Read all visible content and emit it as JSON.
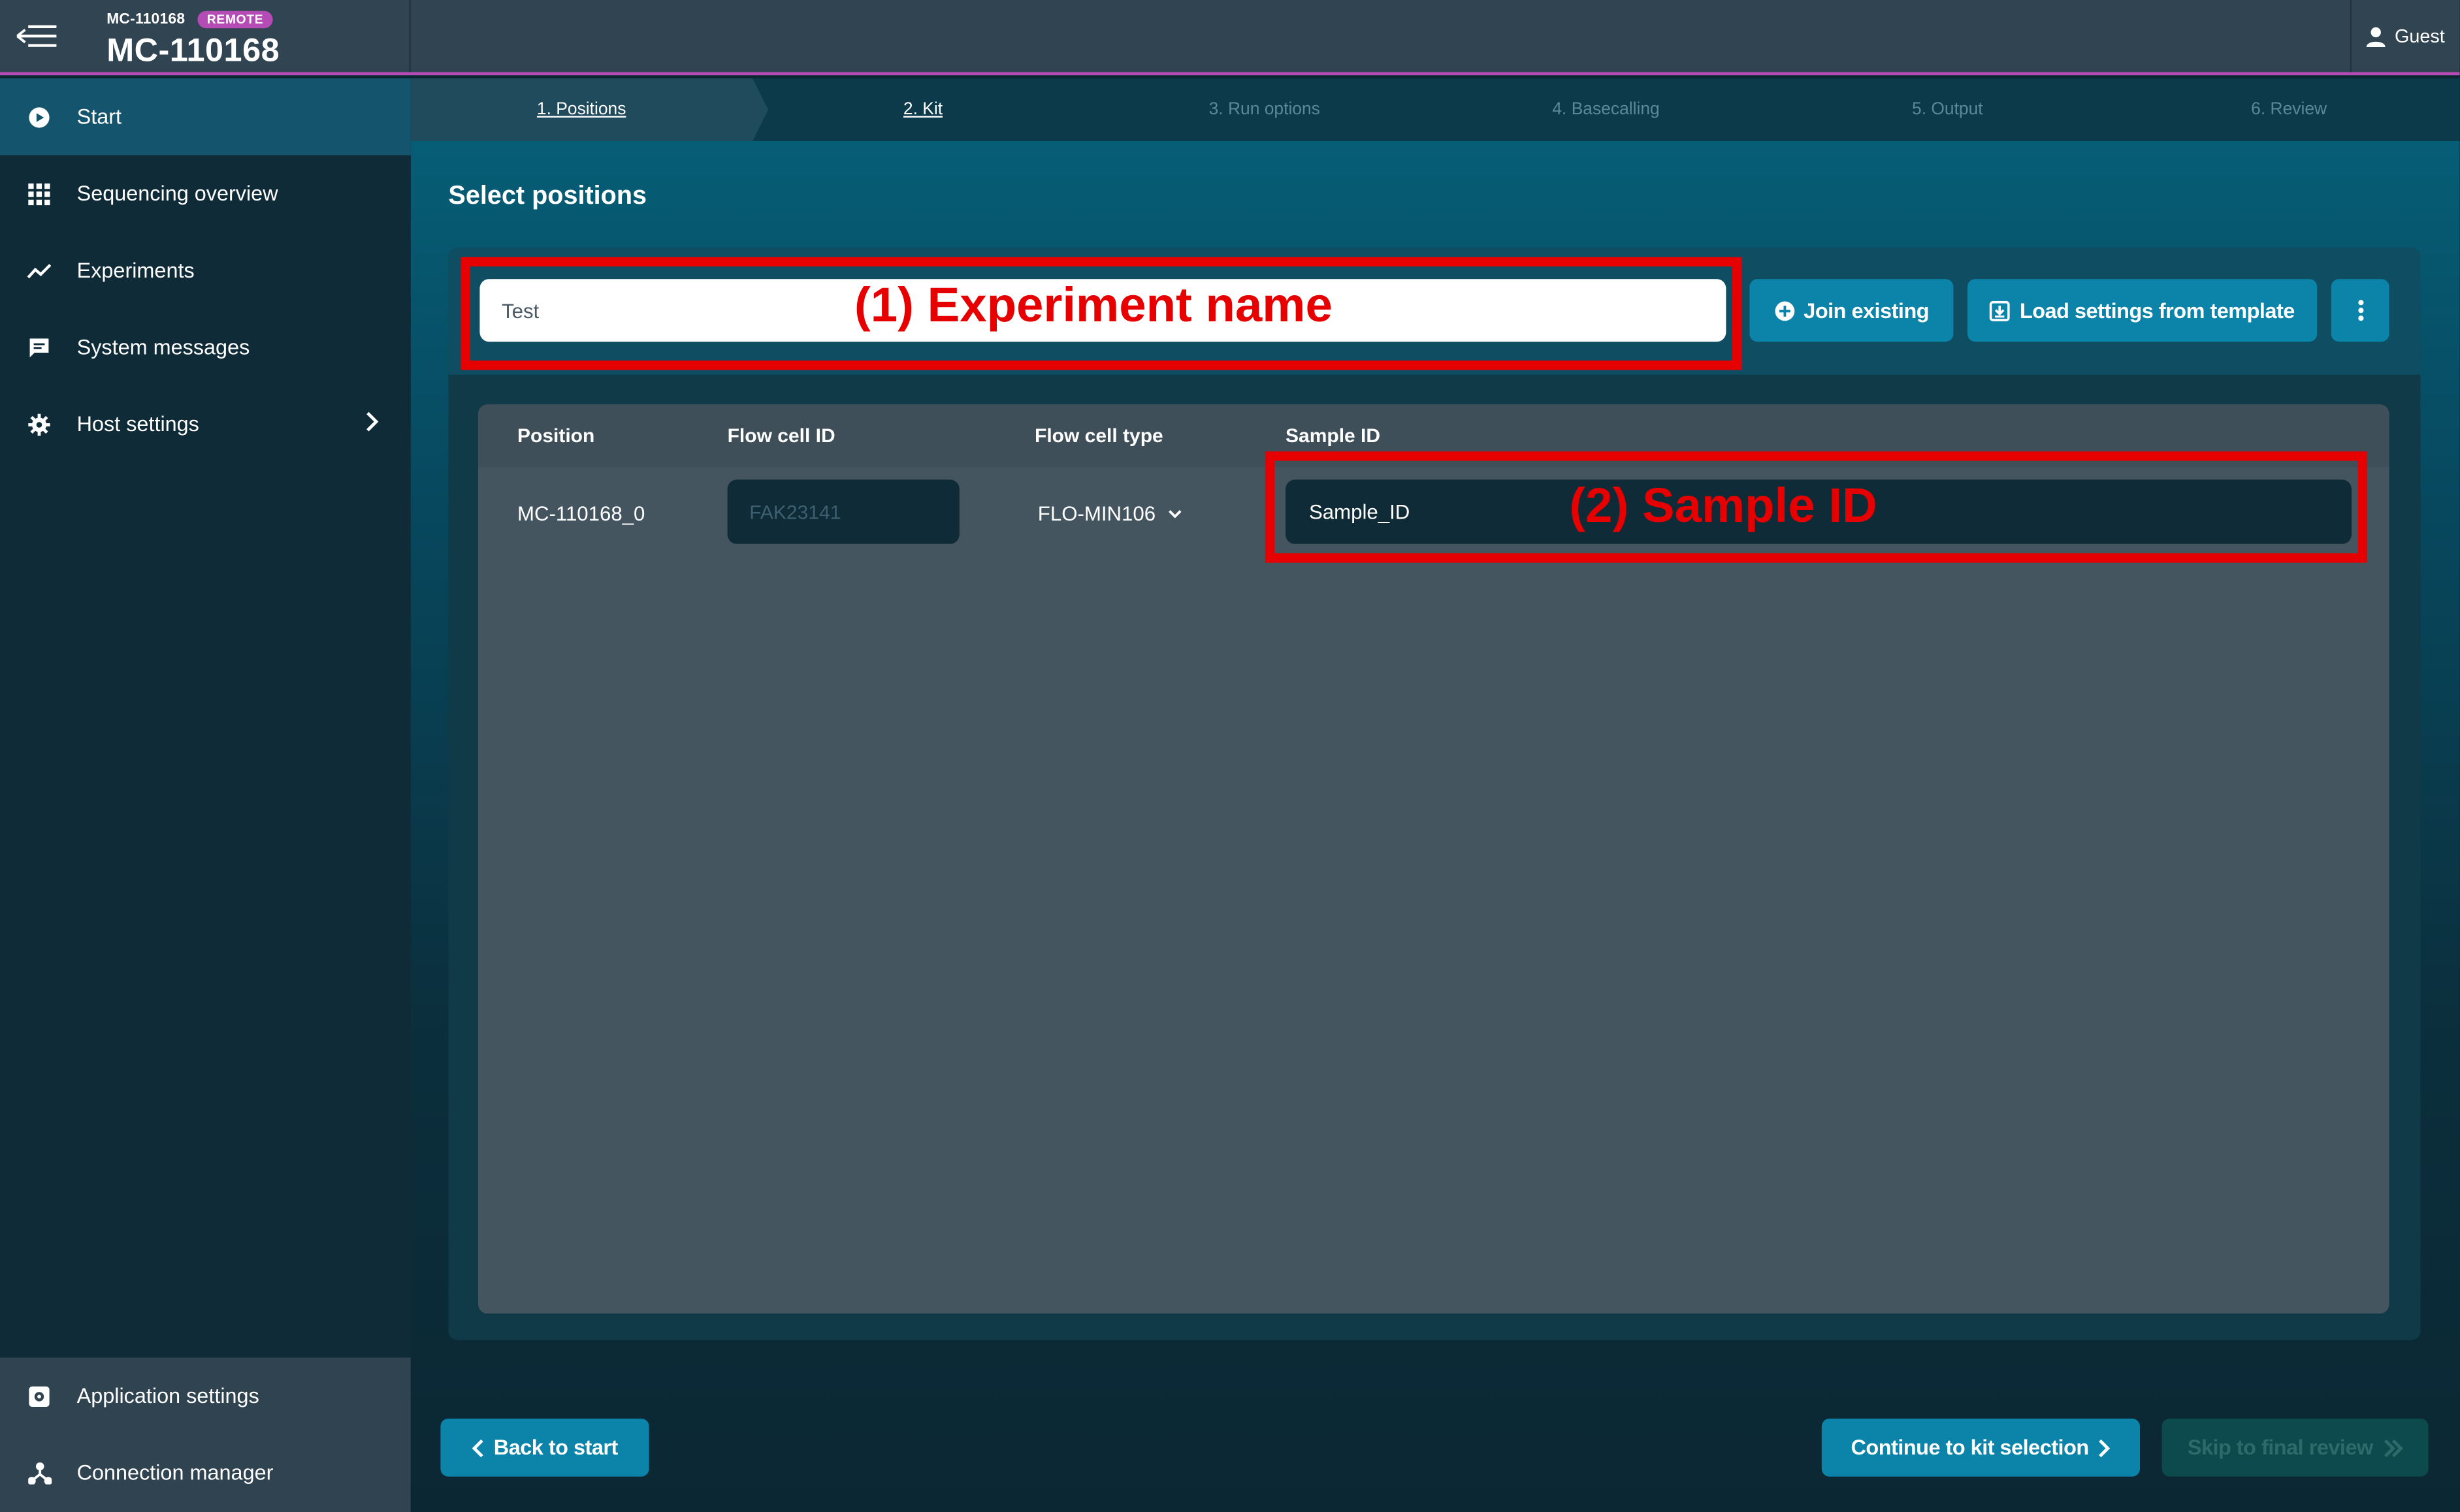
{
  "header": {
    "device_small": "MC-110168",
    "remote_badge": "REMOTE",
    "device_title": "MC-110168",
    "user": "Guest"
  },
  "sidebar": {
    "items": [
      {
        "label": "Start",
        "icon": "play-circle-icon",
        "active": true
      },
      {
        "label": "Sequencing overview",
        "icon": "grid-icon"
      },
      {
        "label": "Experiments",
        "icon": "trend-line-icon"
      },
      {
        "label": "System messages",
        "icon": "chat-icon"
      },
      {
        "label": "Host settings",
        "icon": "gear-icon"
      }
    ],
    "bottom_items": [
      {
        "label": "Application settings",
        "icon": "settings-box-icon"
      },
      {
        "label": "Connection manager",
        "icon": "network-icon"
      }
    ]
  },
  "steps": [
    {
      "label": "1. Positions",
      "state": "current"
    },
    {
      "label": "2. Kit",
      "state": "done"
    },
    {
      "label": "3. Run options",
      "state": "upcoming"
    },
    {
      "label": "4. Basecalling",
      "state": "upcoming"
    },
    {
      "label": "5. Output",
      "state": "upcoming"
    },
    {
      "label": "6. Review",
      "state": "upcoming"
    }
  ],
  "main": {
    "title": "Select positions",
    "experiment_name_value": "Test",
    "join_existing": "Join existing",
    "load_settings": "Load settings from template"
  },
  "annotations": {
    "experiment": "(1) Experiment name",
    "sample": "(2) Sample ID"
  },
  "table": {
    "headers": [
      "Position",
      "Flow cell ID",
      "Flow cell type",
      "Sample ID"
    ],
    "rows": [
      {
        "position": "MC-110168_0",
        "flow_cell_id": "FAK23141",
        "flow_cell_type": "FLO-MIN106",
        "sample_id": "Sample_ID"
      }
    ]
  },
  "footer": {
    "back": "Back to start",
    "continue": "Continue to kit selection",
    "skip": "Skip to final review"
  },
  "colors": {
    "accent": "#0c84aa",
    "annotation": "#e60000",
    "remote": "#b54bb4"
  }
}
